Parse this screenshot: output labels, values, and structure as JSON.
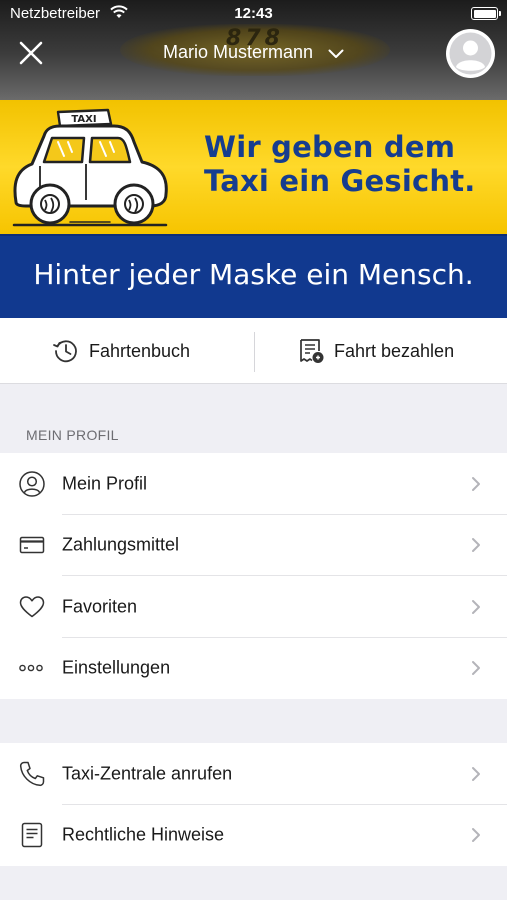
{
  "status_bar": {
    "carrier": "Netzbetreiber",
    "time": "12:43"
  },
  "header": {
    "user_name": "Mario Mustermann",
    "logo_text": "878"
  },
  "banner": {
    "slogan_line1": "Wir geben dem",
    "slogan_line2": "Taxi ein Gesicht.",
    "slogan_bottom": "Hinter jeder Maske ein Mensch.",
    "taxi_sign": "TAXI",
    "colors": {
      "yellow": "#ffd92a",
      "blue": "#11398f",
      "text_blue": "#163d8f"
    }
  },
  "actions": {
    "trip_log": "Fahrtenbuch",
    "pay_trip": "Fahrt bezahlen"
  },
  "profile_section": {
    "label": "MEIN PROFIL",
    "items": [
      {
        "label": "Mein Profil",
        "icon": "user-circle-icon"
      },
      {
        "label": "Zahlungsmittel",
        "icon": "credit-card-icon"
      },
      {
        "label": "Favoriten",
        "icon": "heart-icon"
      },
      {
        "label": "Einstellungen",
        "icon": "more-dots-icon"
      }
    ]
  },
  "info_section": {
    "items": [
      {
        "label": "Taxi-Zentrale anrufen",
        "icon": "phone-icon"
      },
      {
        "label": "Rechtliche Hinweise",
        "icon": "document-icon"
      }
    ]
  }
}
